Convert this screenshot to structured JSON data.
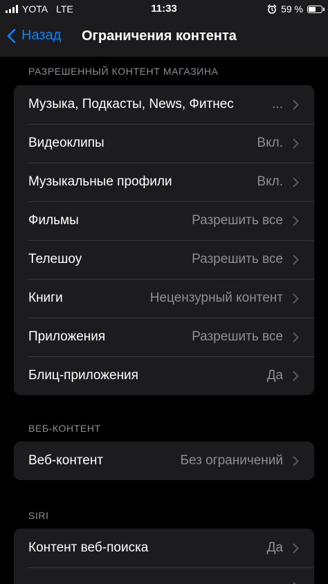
{
  "status_bar": {
    "carrier": "YOTA",
    "network": "LTE",
    "time": "11:33",
    "battery_percent": "59 %",
    "battery_level": 0.59
  },
  "nav": {
    "back_label": "Назад",
    "title": "Ограничения контента"
  },
  "sections": [
    {
      "header": "РАЗРЕШЕННЫЙ КОНТЕНТ МАГАЗИНА",
      "rows": [
        {
          "label": "Музыка, Подкасты, News, Фитнес",
          "value": "..."
        },
        {
          "label": "Видеоклипы",
          "value": "Вкл."
        },
        {
          "label": "Музыкальные профили",
          "value": "Вкл."
        },
        {
          "label": "Фильмы",
          "value": "Разрешить все"
        },
        {
          "label": "Телешоу",
          "value": "Разрешить все"
        },
        {
          "label": "Книги",
          "value": "Нецензурный контент"
        },
        {
          "label": "Приложения",
          "value": "Разрешить все"
        },
        {
          "label": "Блиц-приложения",
          "value": "Да"
        }
      ]
    },
    {
      "header": "ВЕБ-КОНТЕНТ",
      "rows": [
        {
          "label": "Веб-контент",
          "value": "Без ограничений"
        }
      ]
    },
    {
      "header": "SIRI",
      "rows": [
        {
          "label": "Контент веб-поиска",
          "value": "Да"
        },
        {
          "label": "",
          "value": ""
        }
      ]
    }
  ]
}
